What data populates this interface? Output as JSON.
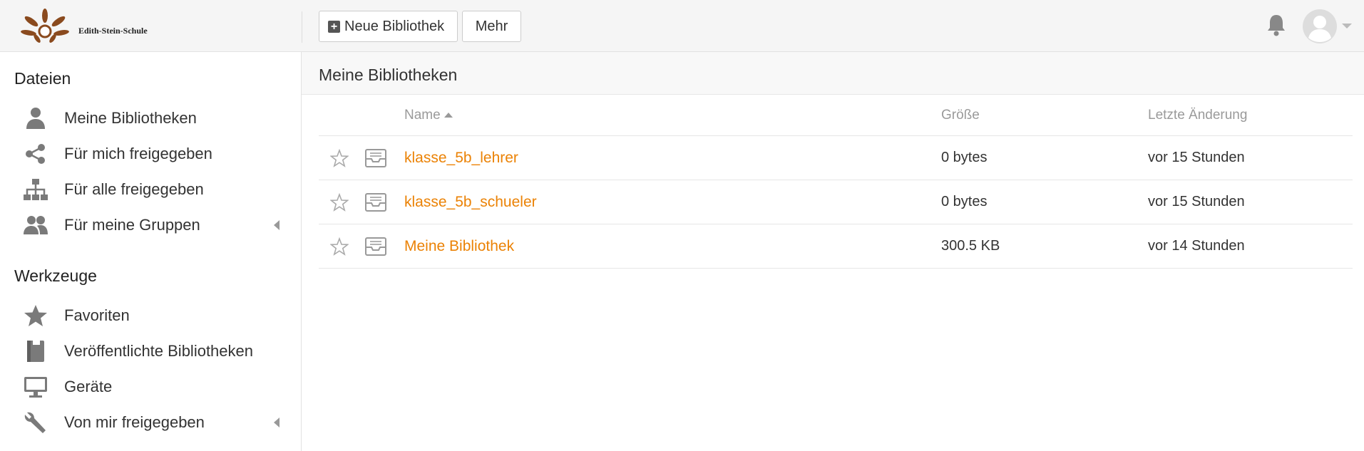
{
  "brand": {
    "name": "Edith-Stein-Schule"
  },
  "toolbar": {
    "new_library_label": "Neue Bibliothek",
    "more_label": "Mehr"
  },
  "sidebar": {
    "files_heading": "Dateien",
    "files_items": [
      {
        "label": "Meine Bibliotheken",
        "icon": "user-icon"
      },
      {
        "label": "Für mich freigegeben",
        "icon": "share-icon"
      },
      {
        "label": "Für alle freigegeben",
        "icon": "org-chart-icon"
      },
      {
        "label": "Für meine Gruppen",
        "icon": "group-icon",
        "expandable": true
      }
    ],
    "tools_heading": "Werkzeuge",
    "tools_items": [
      {
        "label": "Favoriten",
        "icon": "star-icon"
      },
      {
        "label": "Veröffentlichte Bibliotheken",
        "icon": "book-icon"
      },
      {
        "label": "Geräte",
        "icon": "monitor-icon"
      },
      {
        "label": "Von mir freigegeben",
        "icon": "wrench-icon",
        "expandable": true
      }
    ]
  },
  "main": {
    "title": "Meine Bibliotheken",
    "columns": {
      "name": "Name",
      "size": "Größe",
      "modified": "Letzte Änderung"
    },
    "rows": [
      {
        "name": "klasse_5b_lehrer",
        "size": "0 bytes",
        "modified": "vor 15 Stunden"
      },
      {
        "name": "klasse_5b_schueler",
        "size": "0 bytes",
        "modified": "vor 15 Stunden"
      },
      {
        "name": "Meine Bibliothek",
        "size": "300.5 KB",
        "modified": "vor 14 Stunden"
      }
    ]
  },
  "colors": {
    "accent": "#eb8205",
    "icon_gray": "#7a7a7a"
  }
}
